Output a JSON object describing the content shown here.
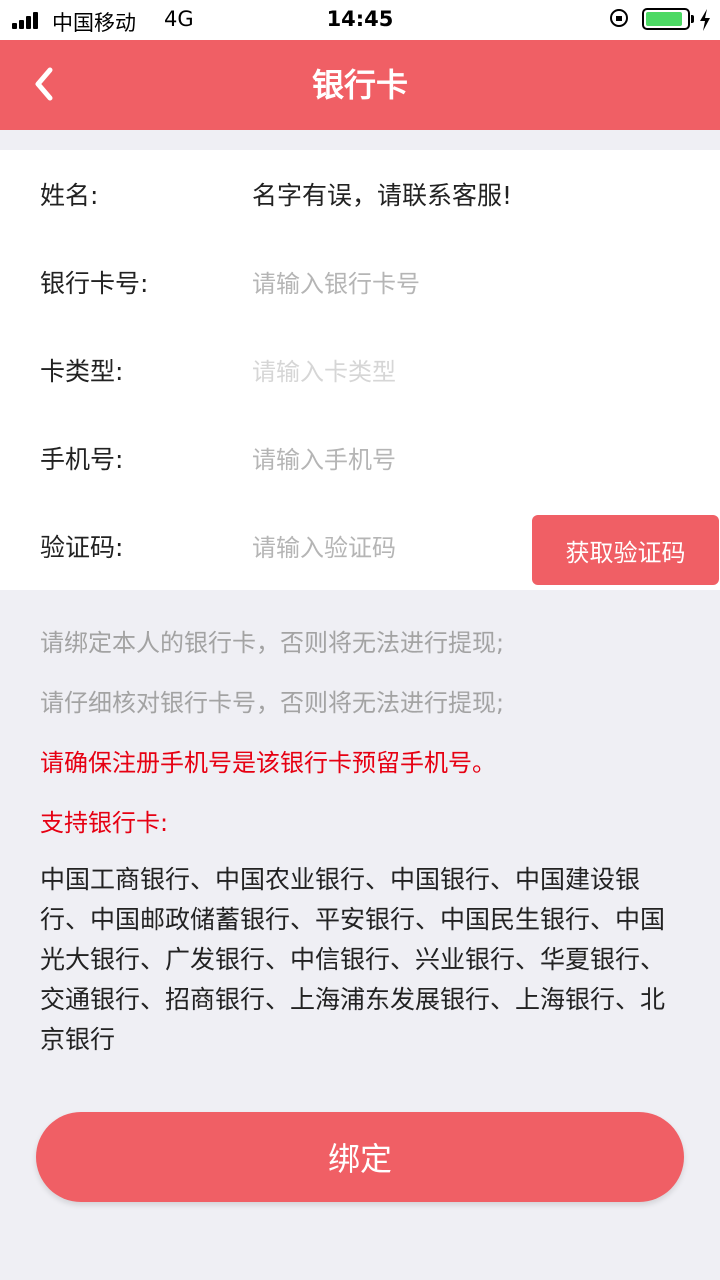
{
  "status_bar": {
    "carrier": "中国移动",
    "network": "4G",
    "time": "14:45",
    "battery_level": 0.9,
    "battery_color": "#4cd964",
    "icons": [
      "signal-icon",
      "rotation-lock-icon",
      "battery-icon",
      "charging-icon"
    ]
  },
  "nav": {
    "title": "银行卡",
    "back_icon": "chevron-left-icon",
    "background_color": "#f05f65"
  },
  "form": {
    "name_label": "姓名:",
    "name_value": "名字有误，请联系客服!",
    "card_number_label": "银行卡号:",
    "card_number_placeholder": "请输入银行卡号",
    "card_type_label": "卡类型:",
    "card_type_placeholder": "请输入卡类型",
    "phone_label": "手机号:",
    "phone_placeholder": "请输入手机号",
    "code_label": "验证码:",
    "code_placeholder": "请输入验证码",
    "get_code_button": "获取验证码"
  },
  "notes": {
    "note1": "请绑定本人的银行卡，否则将无法进行提现;",
    "note2": "请仔细核对银行卡号，否则将无法进行提现;",
    "note3": "请确保注册手机号是该银行卡预留手机号。",
    "supported_title": "支持银行卡:",
    "supported_banks": "中国工商银行、中国农业银行、中国银行、中国建设银行、中国邮政储蓄银行、平安银行、中国民生银行、中国光大银行、广发银行、中信银行、兴业银行、华夏银行、交通银行、招商银行、上海浦东发展银行、上海银行、北京银行"
  },
  "bind_button": "绑定",
  "colors": {
    "accent": "#f05f65",
    "warning_text": "#e60012",
    "muted_text": "#a3a3a3",
    "page_background": "#efeff4"
  }
}
